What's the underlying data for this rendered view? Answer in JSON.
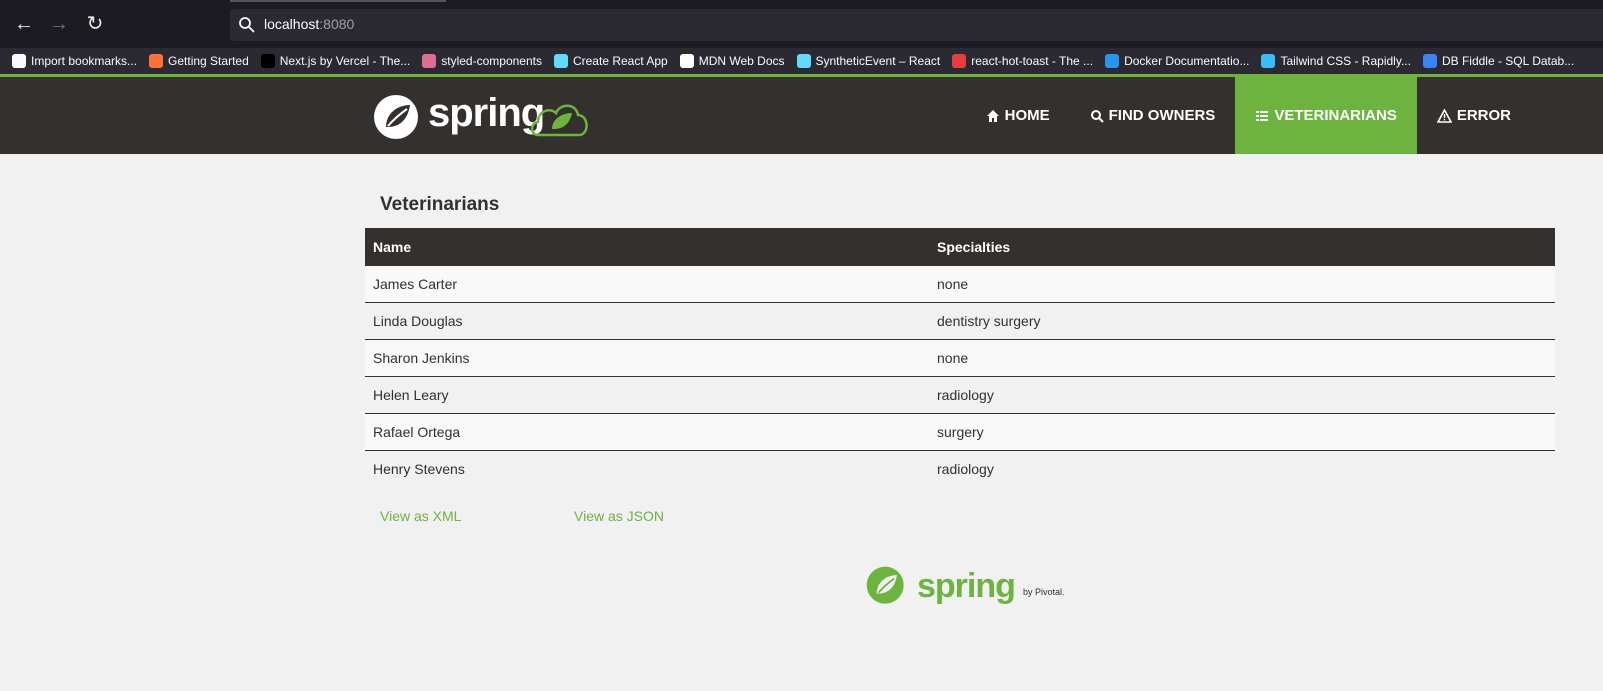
{
  "browser": {
    "url_host": "localhost",
    "url_port": ":8080",
    "bookmarks": [
      {
        "label": "Import bookmarks...",
        "icon": "import-icon",
        "color": "#fbfbfe"
      },
      {
        "label": "Getting Started",
        "icon": "firefox-icon",
        "color": "#ff7139"
      },
      {
        "label": "Next.js by Vercel - The...",
        "icon": "nextjs-icon",
        "color": "#000000"
      },
      {
        "label": "styled-components",
        "icon": "styled-components-icon",
        "color": "#db7093"
      },
      {
        "label": "Create React App",
        "icon": "react-icon",
        "color": "#61dafb"
      },
      {
        "label": "MDN Web Docs",
        "icon": "mdn-icon",
        "color": "#ffffff"
      },
      {
        "label": "SyntheticEvent – React",
        "icon": "react-icon",
        "color": "#61dafb"
      },
      {
        "label": "react-hot-toast - The ...",
        "icon": "toast-icon",
        "color": "#e53e3e"
      },
      {
        "label": "Docker Documentatio...",
        "icon": "docker-icon",
        "color": "#2496ed"
      },
      {
        "label": "Tailwind CSS - Rapidly...",
        "icon": "tailwind-icon",
        "color": "#38bdf8"
      },
      {
        "label": "DB Fiddle - SQL Datab...",
        "icon": "database-icon",
        "color": "#3b82f6"
      }
    ]
  },
  "navbar": {
    "brand": "spring",
    "items": [
      {
        "label": "Home",
        "icon": "home-icon",
        "active": false
      },
      {
        "label": "Find owners",
        "icon": "search-icon",
        "active": false
      },
      {
        "label": "Veterinarians",
        "icon": "list-icon",
        "active": true
      },
      {
        "label": "Error",
        "icon": "warning-icon",
        "active": false
      }
    ]
  },
  "page": {
    "title": "Veterinarians",
    "table": {
      "headers": [
        "Name",
        "Specialties"
      ],
      "rows": [
        [
          "James Carter",
          "none"
        ],
        [
          "Linda Douglas",
          "dentistry surgery"
        ],
        [
          "Sharon Jenkins",
          "none"
        ],
        [
          "Helen Leary",
          "radiology"
        ],
        [
          "Rafael Ortega",
          "surgery"
        ],
        [
          "Henry Stevens",
          "radiology"
        ]
      ]
    },
    "links": {
      "xml": "View as XML",
      "json": "View as JSON"
    }
  },
  "footer": {
    "brand": "spring",
    "byline": "by Pivotal."
  },
  "colors": {
    "accent": "#6db33f",
    "dark": "#34302d"
  }
}
